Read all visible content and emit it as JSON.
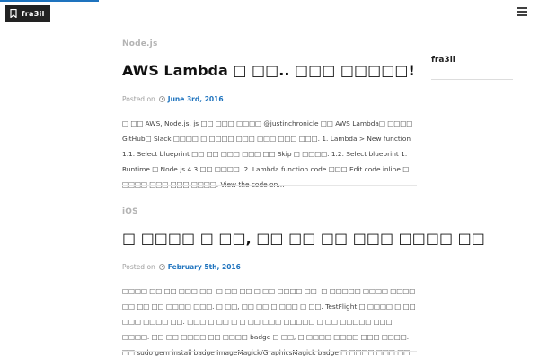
{
  "site": {
    "badge_label": "fra3il"
  },
  "colors": {
    "accent": "#1e73be",
    "badge_bg": "#222222",
    "category": "#b3b3b3"
  },
  "posts": [
    {
      "category": "Node.js",
      "title": "AWS Lambda □ □□.. □□□ □□□□□!",
      "posted_on_label": "Posted on",
      "date": "June 3rd, 2016",
      "excerpt": "□ □□ AWS, Node.js, js □□ □□□ □□□□ @justinchronicle □□ AWS Lambda□ □□□□ GitHub□ Slack □□□□ □ □□□□ □□□ □□□ □□□ □□□. 1. Lambda > New function 1.1. Select blueprint □□ □□ □□□ □□□ □□ Skip □ □□□□. 1.2. Select blueprint 1. Runtime □ Node.js 4.3 □□ □□□□. 2. Lambda function code □□□ Edit code inline □ □□□□ □□□ □□□ □□□□. View the code on…"
    },
    {
      "category": "iOS",
      "title": "□ □□□□ □ □□, □□ □□ □□ □□□ □□□□ □□",
      "posted_on_label": "Posted on",
      "date": "February 5th, 2016",
      "excerpt": "□□□□ □□ □□ □□□ □□. □ □□ □□ □ □□ □□□□ □□. □ □□□□□ □□□□ □□□□ □□ □□ □□ □□□□ □□□. □ □□, □□ □□ □ □□□ □ □□. TestFlight □ □□□□ □ □□ □□□ □□□□ □□. □□□ □ □□ □ □ □□ □□□ □□□□□ □ □□ □□□□□ □□□ □□□□. □□ □□ □□□□ □□ □□□□ badge □ □□, □ □□□□ □□□□ □□□ □□□□. □□ sudo gem install badge ImageMagick/GraphicsMagick badge □ □□□□ □□□ □□ □□ □□□□ □□□ □□□ □□...."
    }
  ],
  "sidebar": {
    "title": "fra3il"
  },
  "icons": {
    "badge": "bookmark-icon",
    "menu": "hamburger-menu-icon",
    "date": "clock-icon"
  }
}
